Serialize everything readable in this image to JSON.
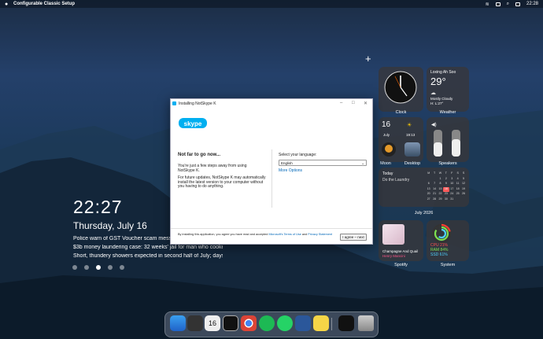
{
  "menubar": {
    "apple": "",
    "app_name": "Configurable Classic Setup",
    "time": "22:28"
  },
  "lock": {
    "time": "22:27",
    "date": "Thursday, July 16",
    "news": [
      "Police warn of GST Voucher scam messages t...",
      "$3b money laundering case: 32 weeks' jail for man who cooked fi...",
      "Short, thundery showers expected in second half of July; days to..."
    ]
  },
  "widgets": {
    "clock": {
      "label": "Clock"
    },
    "weather": {
      "location": "Loxing Ah Soo",
      "temp": "29°",
      "cond": "Mostly Cloudy",
      "hilo": "H: L:27°",
      "label": "Weather"
    },
    "calendar_small": {
      "day": "16",
      "month": "July",
      "time": "19:13"
    },
    "moon": {
      "label": "Moon"
    },
    "desktop": {
      "label": "Desktop"
    },
    "speakers": {
      "label": "Speakers"
    },
    "todo": {
      "head": "Today",
      "item": "Do the Laundry"
    },
    "month_cal": {
      "label": "July 2026",
      "weekdays": [
        "M",
        "T",
        "W",
        "T",
        "F",
        "S",
        "S"
      ],
      "weeks": [
        [
          "",
          "",
          "1",
          "2",
          "3",
          "4",
          "5"
        ],
        [
          "6",
          "7",
          "8",
          "9",
          "10",
          "11",
          "12"
        ],
        [
          "13",
          "14",
          "15",
          "16",
          "17",
          "18",
          "19"
        ],
        [
          "20",
          "21",
          "22",
          "23",
          "24",
          "25",
          "26"
        ],
        [
          "27",
          "28",
          "29",
          "30",
          "31",
          "",
          ""
        ]
      ],
      "today": "16"
    },
    "spotify": {
      "track": "Champagne And Quail",
      "artist": "Henry Mancini",
      "label": "Spotify"
    },
    "system": {
      "cpu": "CPU 21%",
      "ram": "RAM 84%",
      "ssd": "SSD 61%",
      "label": "System",
      "ring_cpu": 0.21,
      "ring_ram": 0.84,
      "ring_ssd": 0.61
    }
  },
  "dialog": {
    "title": "Installing NotSkype K",
    "logo": "skype",
    "heading": "Not far to go now...",
    "p1": "You're just a few steps away from using NotSkype K.",
    "p2": "For future updates, NotSkype K may automatically install the latest version to your computer without you having to do anything.",
    "lang_label": "Select your language:",
    "lang_value": "English",
    "more_options": "More Options",
    "footer_pre": "By installing this application, you agree you have read and accepted ",
    "footer_tou": "Microsoft's Terms of Use",
    "footer_and": " and ",
    "footer_privacy": "Privacy Statement",
    "agree_button": "I agree – next"
  },
  "dock": {
    "items": [
      "finder",
      "launchpad",
      "calendar",
      "clock",
      "chrome",
      "spotify",
      "whatsapp",
      "word",
      "notes",
      "activity",
      "trash"
    ],
    "calendar_day": "16"
  }
}
